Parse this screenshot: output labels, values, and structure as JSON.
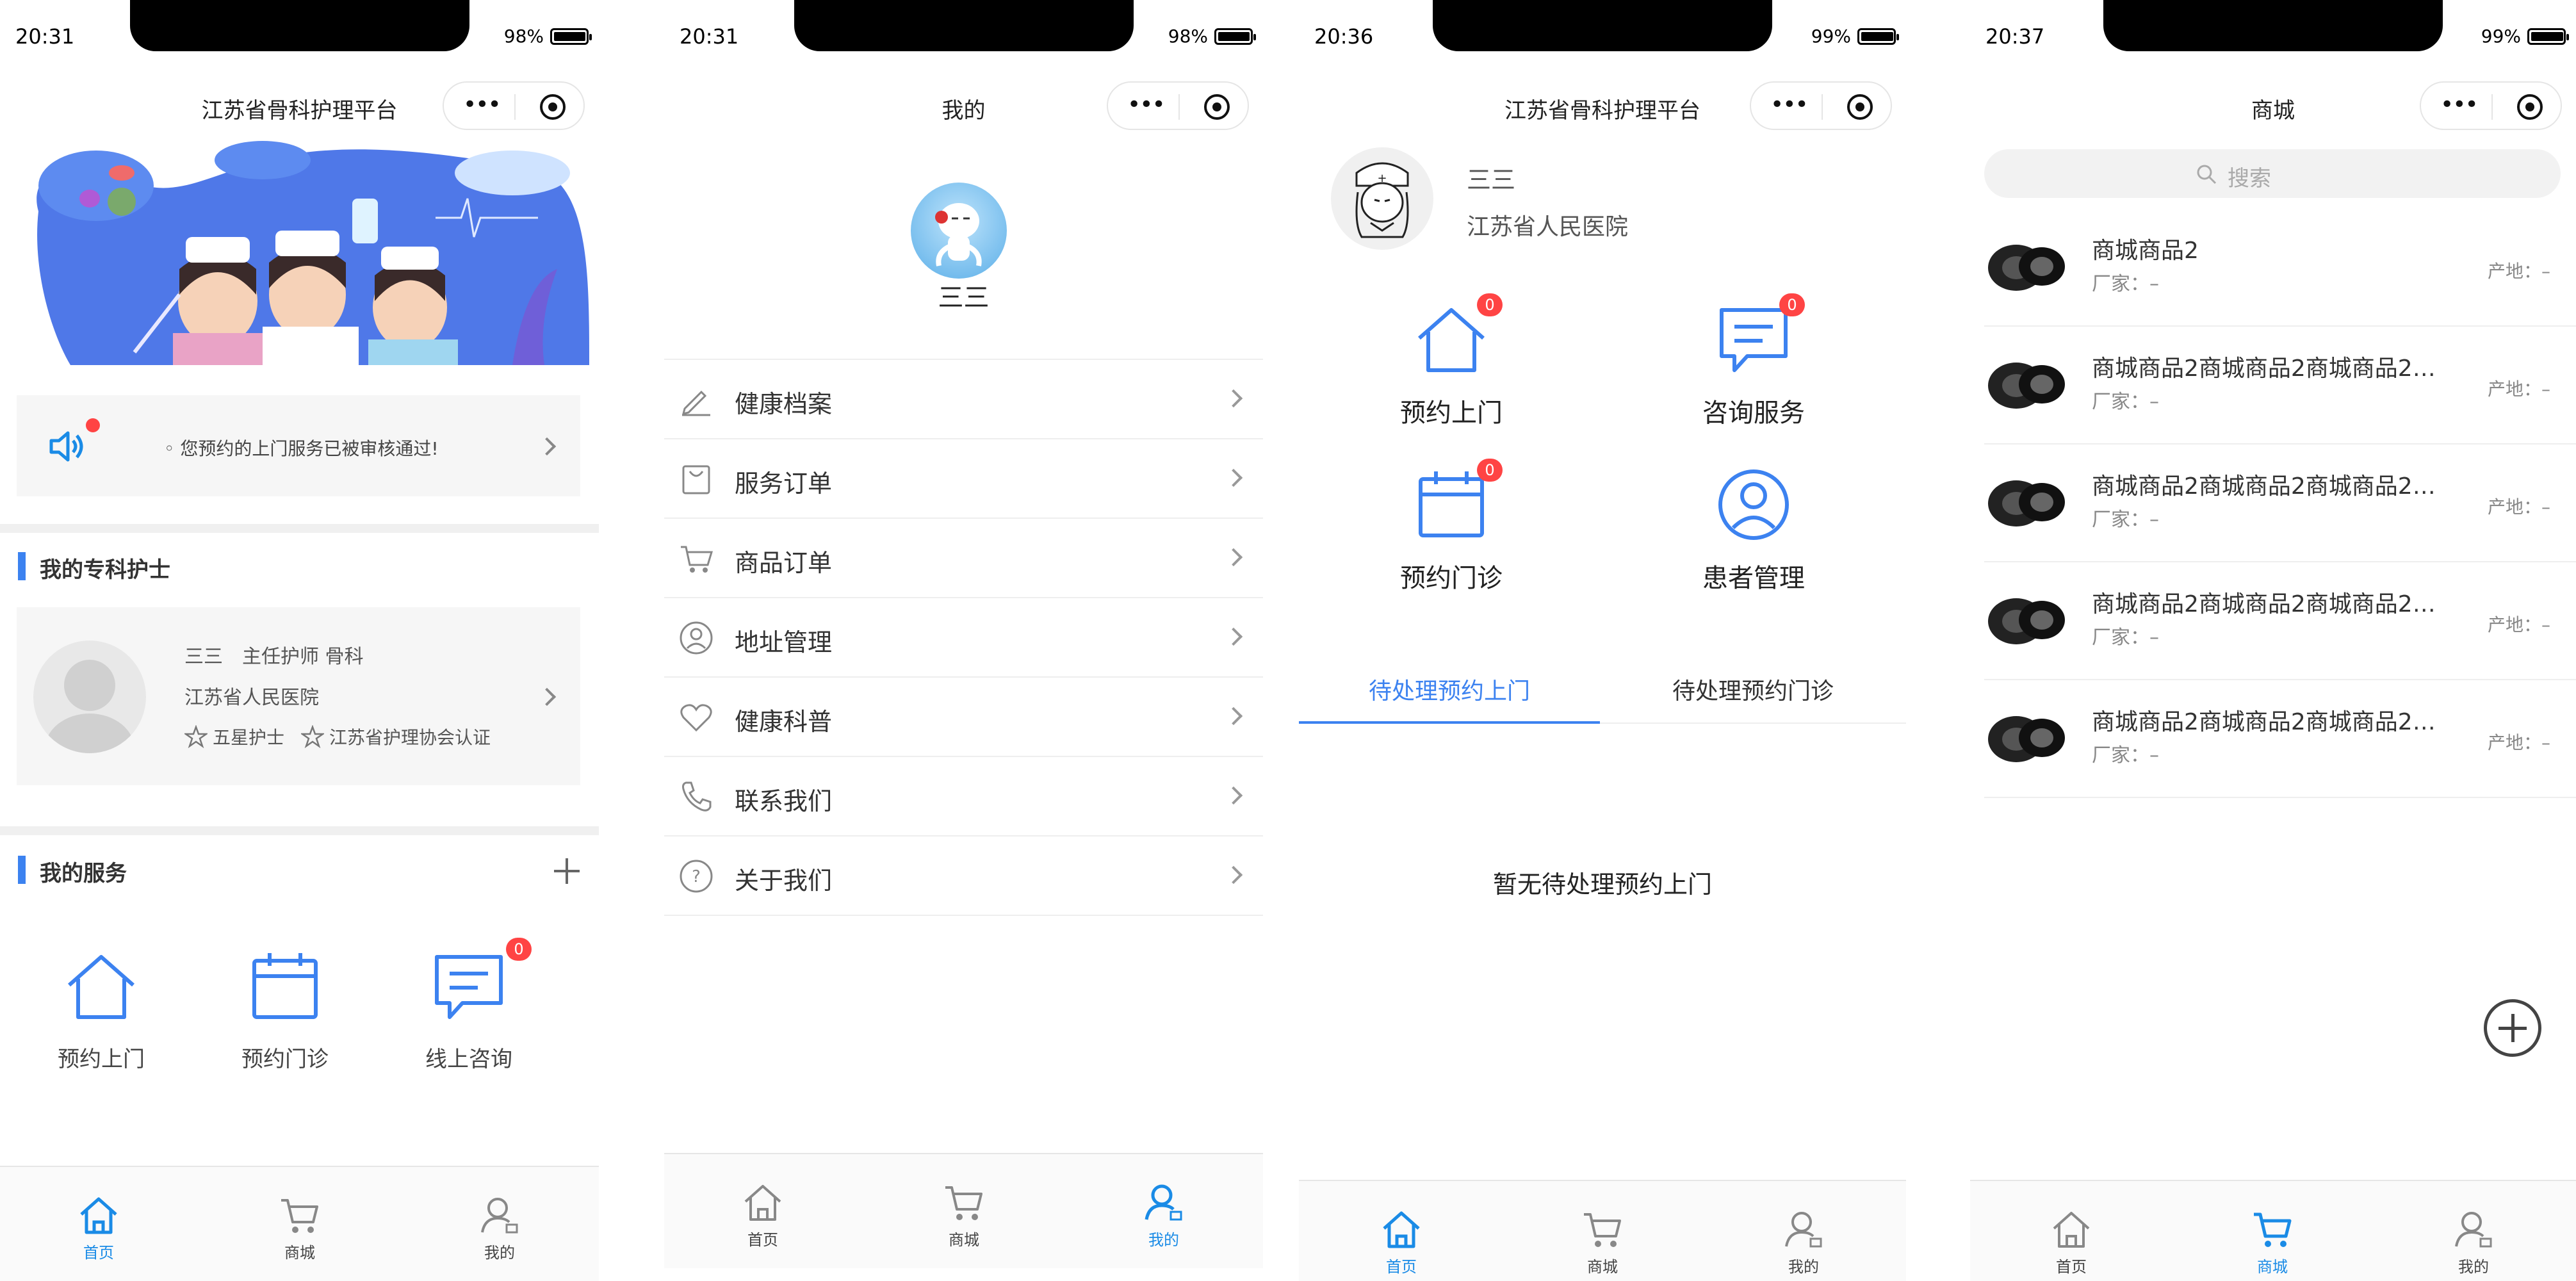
{
  "panels": {
    "home": {
      "status": {
        "time": "20:31",
        "battery": "98%",
        "battery_level": 0.98
      },
      "title": "江苏省骨科护理平台",
      "notice": "◦ 您预约的上门服务已被审核通过!",
      "nurse_section": "我的专科护士",
      "nurse": {
        "line1": "三三　主任护师 骨科",
        "hospital": "江苏省人民医院",
        "tag1": "五星护士",
        "tag2": "江苏省护理协会认证"
      },
      "service_section": "我的服务",
      "services": [
        {
          "label": "预约上门",
          "icon": "house-icon"
        },
        {
          "label": "预约门诊",
          "icon": "calendar-icon"
        },
        {
          "label": "线上咨询",
          "icon": "chat-icon",
          "badge": "0"
        }
      ]
    },
    "mine": {
      "status": {
        "time": "20:31",
        "battery": "98%",
        "battery_level": 0.98
      },
      "title": "我的",
      "name": "三三",
      "menu": [
        {
          "label": "健康档案",
          "icon": "pen-icon"
        },
        {
          "label": "服务订单",
          "icon": "bag-icon"
        },
        {
          "label": "商品订单",
          "icon": "cart-icon"
        },
        {
          "label": "地址管理",
          "icon": "user-circle-icon"
        },
        {
          "label": "健康科普",
          "icon": "heart-icon"
        },
        {
          "label": "联系我们",
          "icon": "phone-icon"
        },
        {
          "label": "关于我们",
          "icon": "question-icon"
        }
      ]
    },
    "nurse_home": {
      "status": {
        "time": "20:36",
        "battery": "99%",
        "battery_level": 0.99
      },
      "title": "江苏省骨科护理平台",
      "name": "三三",
      "hospital": "江苏省人民医院",
      "grid": [
        {
          "label": "预约上门",
          "badge": "0"
        },
        {
          "label": "咨询服务",
          "badge": "0"
        },
        {
          "label": "预约门诊",
          "badge": "0"
        },
        {
          "label": "患者管理"
        }
      ],
      "tabs": [
        "待处理预约上门",
        "待处理预约门诊"
      ],
      "empty": "暂无待处理预约上门"
    },
    "shop": {
      "status": {
        "time": "20:37",
        "battery": "99%",
        "battery_level": 0.99
      },
      "title": "商城",
      "search_placeholder": "搜索",
      "goods": [
        {
          "name": "商城商品2",
          "maker": "厂家：–",
          "origin": "产地：–"
        },
        {
          "name": "商城商品2商城商品2商城商品2…",
          "maker": "厂家：–",
          "origin": "产地：–"
        },
        {
          "name": "商城商品2商城商品2商城商品2…",
          "maker": "厂家：–",
          "origin": "产地：–"
        },
        {
          "name": "商城商品2商城商品2商城商品2…",
          "maker": "厂家：–",
          "origin": "产地：–"
        },
        {
          "name": "商城商品2商城商品2商城商品2…",
          "maker": "厂家：–",
          "origin": "产地：–"
        }
      ]
    }
  },
  "tabbar": {
    "home": "首页",
    "shop": "商城",
    "mine": "我的"
  },
  "colors": {
    "accent": "#3c82f0",
    "tab_active": "#1a8be6",
    "badge": "#ff4444"
  }
}
